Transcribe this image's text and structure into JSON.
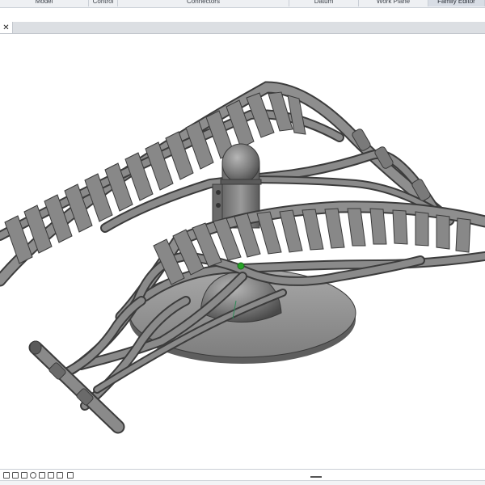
{
  "ribbon": {
    "panels": [
      {
        "label": "Model"
      },
      {
        "label": "Control"
      },
      {
        "label": "Connectors"
      },
      {
        "label": "Datum"
      },
      {
        "label": "Work Plane"
      },
      {
        "label": "Family Editor",
        "active": true
      }
    ]
  },
  "view_tabs": {
    "close_glyph": "✕"
  },
  "viewport": {
    "model_color": "#8c8c8c",
    "origin_marker_color": "#27a327"
  },
  "view_control_bar": {
    "icons": [
      "scale-icon",
      "detail-level-icon",
      "visual-style-icon",
      "sun-path-icon",
      "shadows-icon",
      "crop-icon",
      "show-crop-icon"
    ]
  }
}
